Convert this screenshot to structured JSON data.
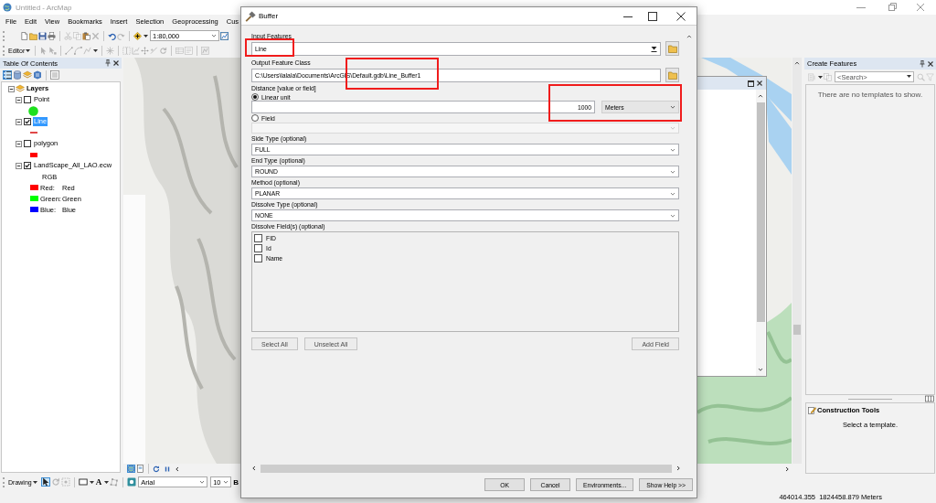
{
  "window": {
    "title": "Untitled - ArcMap"
  },
  "menu_bar": [
    "File",
    "Edit",
    "View",
    "Bookmarks",
    "Insert",
    "Selection",
    "Geoprocessing",
    "Cus"
  ],
  "standard_toolbar": {
    "groups": [
      [
        {
          "kind": "new",
          "disabled": false,
          "pressed": false
        },
        {
          "kind": "open",
          "disabled": false,
          "pressed": false
        },
        {
          "kind": "save",
          "disabled": false,
          "pressed": false
        },
        {
          "kind": "print",
          "disabled": false,
          "pressed": false
        }
      ],
      [
        {
          "kind": "cut",
          "disabled": true,
          "pressed": false
        },
        {
          "kind": "copy",
          "disabled": true,
          "pressed": false
        },
        {
          "kind": "paste",
          "disabled": false,
          "pressed": false
        },
        {
          "kind": "delete",
          "disabled": true,
          "pressed": false
        }
      ],
      [
        {
          "kind": "undo",
          "disabled": false,
          "pressed": false
        },
        {
          "kind": "redo",
          "disabled": true,
          "pressed": false
        }
      ],
      [
        {
          "kind": "adddata",
          "disabled": false,
          "pressed": false
        },
        {
          "kind": "scale",
          "value": "1:80,000"
        },
        {
          "kind": "graph",
          "disabled": false,
          "pressed": true
        }
      ]
    ]
  },
  "editor_toolbar": {
    "label": "Editor",
    "groups": [
      [
        {
          "kind": "pointer",
          "disabled": true
        },
        {
          "kind": "vertex",
          "disabled": true
        }
      ],
      [
        {
          "kind": "line",
          "disabled": true
        },
        {
          "kind": "curve",
          "disabled": true
        },
        {
          "kind": "polyline",
          "disabled": true
        }
      ],
      [
        {
          "kind": "asterisk",
          "disabled": true
        }
      ],
      [
        {
          "kind": "split",
          "disabled": true
        },
        {
          "kind": "trace",
          "disabled": true
        },
        {
          "kind": "move",
          "disabled": true
        },
        {
          "kind": "reshape",
          "disabled": true
        },
        {
          "kind": "rotate",
          "disabled": true
        }
      ],
      [
        {
          "kind": "table",
          "disabled": true
        },
        {
          "kind": "attributes",
          "disabled": true
        }
      ],
      [
        {
          "kind": "sketch",
          "disabled": true
        }
      ]
    ]
  },
  "table_of_contents": {
    "title": "Table Of Contents",
    "toolbar": [
      [
        {
          "kind": "drawingorder",
          "selected": true
        },
        {
          "kind": "source",
          "selected": false
        },
        {
          "kind": "visibility",
          "selected": false
        },
        {
          "kind": "selection",
          "selected": false
        }
      ],
      [
        {
          "kind": "options",
          "selected": false
        }
      ]
    ],
    "tree": [
      {
        "label": "Layers",
        "expanded": true,
        "selected": false,
        "children": [
          {
            "label": "Point",
            "checked": false,
            "selected": false,
            "expanded": true,
            "legend": [
              {
                "kind": "point",
                "color": "#1ee01e"
              }
            ]
          },
          {
            "label": "Line",
            "checked": true,
            "selected": true,
            "expanded": true,
            "legend": [
              {
                "kind": "line",
                "color": "#e04848"
              }
            ]
          },
          {
            "label": "polygon",
            "checked": false,
            "selected": false,
            "expanded": true,
            "legend": [
              {
                "kind": "fill",
                "color": "#ff0000"
              }
            ]
          },
          {
            "label": "LandScape_All_LAO.ecw",
            "checked": true,
            "selected": false,
            "expanded": true,
            "legend": [
              {
                "kind": "heading",
                "label": "RGB"
              },
              {
                "kind": "band",
                "color": "#ff0000",
                "label": "Red:",
                "value": "Red"
              },
              {
                "kind": "band",
                "color": "#00ff00",
                "label": "Green:",
                "value": "Green"
              },
              {
                "kind": "band",
                "color": "#0000ff",
                "label": "Blue:",
                "value": "Blue"
              }
            ]
          }
        ]
      }
    ]
  },
  "map": {
    "view_buttons": [
      {
        "kind": "dataview",
        "selected": true
      },
      {
        "kind": "layoutview",
        "selected": false
      }
    ]
  },
  "create_features": {
    "title": "Create Features",
    "tools": [
      {
        "kind": "organize",
        "disabled": true
      },
      {
        "kind": "copytemplate",
        "disabled": true
      },
      {
        "kind": "search",
        "placeholder": "<Search>",
        "disabled": false
      },
      {
        "kind": "find",
        "disabled": true
      },
      {
        "kind": "clear",
        "disabled": true
      }
    ],
    "message": "There are no templates to show."
  },
  "construction_tools": {
    "title": "Construction Tools",
    "message": "Select a template."
  },
  "drawing_toolbar": {
    "label": "Drawing",
    "groups": [
      [
        {
          "kind": "pointer",
          "disabled": false,
          "pressed": true
        },
        {
          "kind": "rotate",
          "disabled": true,
          "pressed": false
        },
        {
          "kind": "zoomselected",
          "disabled": true,
          "pressed": false
        }
      ],
      [
        {
          "kind": "rectangle",
          "disabled": false,
          "pressed": false
        },
        {
          "kind": "text",
          "label": "A",
          "disabled": false,
          "pressed": false
        },
        {
          "kind": "vertices",
          "disabled": true,
          "pressed": false
        }
      ],
      [
        {
          "kind": "font",
          "value": "Arial"
        },
        {
          "kind": "fontsize",
          "value": "10"
        },
        {
          "kind": "bold",
          "label": "B",
          "disabled": false,
          "pressed": false
        }
      ]
    ]
  },
  "status_bar": {
    "coordinates": "464014.355  1824458.879 Meters"
  },
  "buffer_dialog": {
    "title": "Buffer",
    "parameters": [
      {
        "kind": "combo",
        "label": "Input Features",
        "value": "Line",
        "highlighted": true
      },
      {
        "kind": "path",
        "label": "Output Feature Class",
        "value": "C:\\Users\\lalala\\Documents\\ArcGIS\\Default.gdb\\Line_Buffer1",
        "highlighted": true
      },
      {
        "kind": "distance",
        "label": "Distance [value or field]",
        "options": [
          {
            "label": "Linear unit",
            "selected": true
          },
          {
            "label": "Field",
            "selected": false
          }
        ],
        "value": "1000",
        "unit": "Meters",
        "highlighted": true
      },
      {
        "kind": "choice",
        "label": "Side Type (optional)",
        "value": "FULL",
        "highlighted": false
      },
      {
        "kind": "choice",
        "label": "End Type (optional)",
        "value": "ROUND",
        "highlighted": false
      },
      {
        "kind": "choice",
        "label": "Method (optional)",
        "value": "PLANAR",
        "highlighted": false
      },
      {
        "kind": "choice",
        "label": "Dissolve Type (optional)",
        "value": "NONE",
        "highlighted": false
      },
      {
        "kind": "checklist",
        "label": "Dissolve Field(s) (optional)",
        "items": [
          {
            "label": "FID",
            "checked": false
          },
          {
            "label": "Id",
            "checked": false
          },
          {
            "label": "Name",
            "checked": false
          }
        ],
        "buttons": [
          {
            "label": "Select All",
            "disabled": true
          },
          {
            "label": "Unselect All",
            "disabled": true
          },
          {
            "label": "Add Field",
            "disabled": true
          }
        ],
        "highlighted": false
      }
    ],
    "buttons": [
      "OK",
      "Cancel",
      "Environments...",
      "Show Help >>"
    ]
  }
}
